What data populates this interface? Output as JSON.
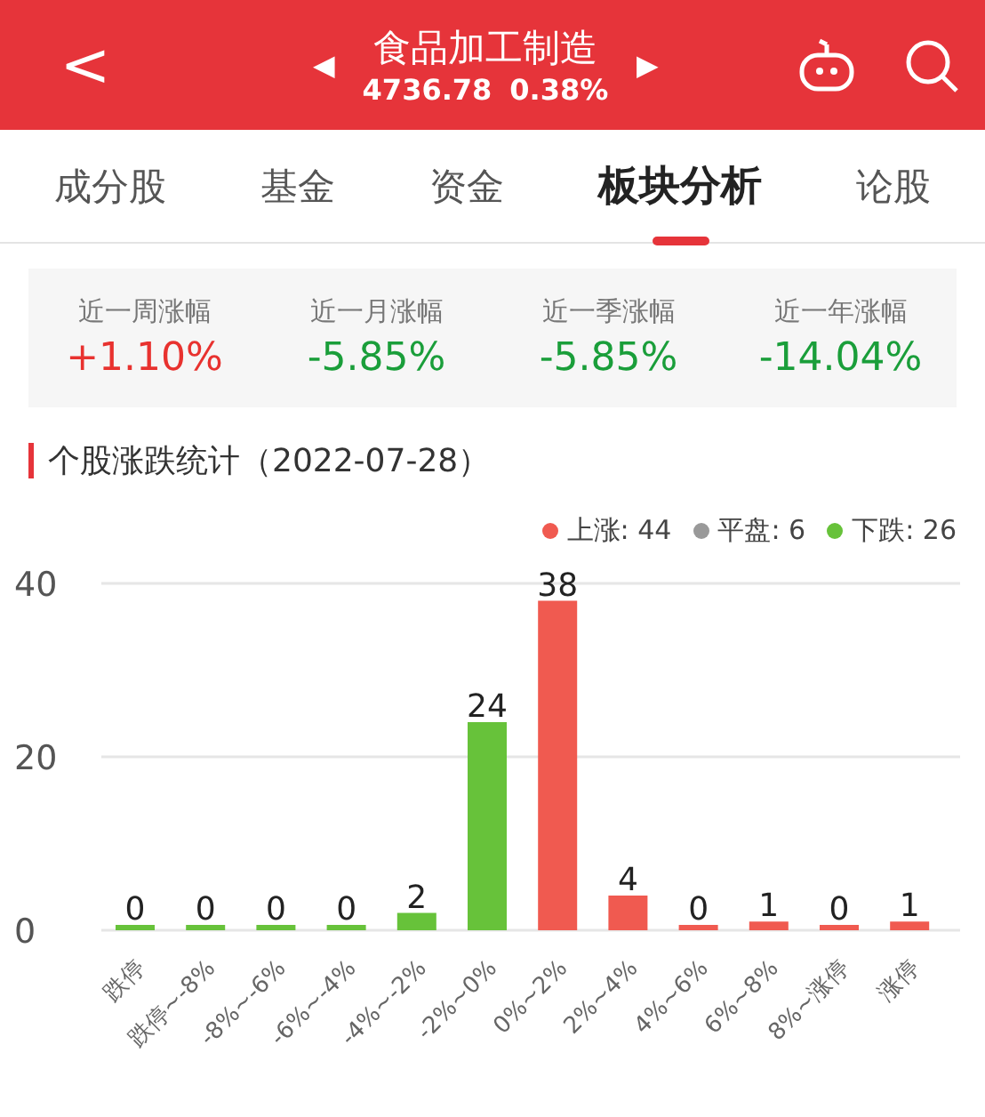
{
  "header": {
    "back": "<",
    "prev": "◀",
    "next": "▶",
    "title": "食品加工制造",
    "price": "4736.78",
    "change": "0.38%"
  },
  "tabs": [
    {
      "label": "成分股",
      "selected": false
    },
    {
      "label": "基金",
      "selected": false
    },
    {
      "label": "资金",
      "selected": false
    },
    {
      "label": "板块分析",
      "selected": true
    },
    {
      "label": "论股",
      "selected": false
    }
  ],
  "stats": [
    {
      "label": "近一周涨幅",
      "value": "+1.10%",
      "color": "#e8322f"
    },
    {
      "label": "近一月涨幅",
      "value": "-5.85%",
      "color": "#1a9e3a"
    },
    {
      "label": "近一季涨幅",
      "value": "-5.85%",
      "color": "#1a9e3a"
    },
    {
      "label": "近一年涨幅",
      "value": "-14.04%",
      "color": "#1a9e3a"
    }
  ],
  "section_title": "个股涨跌统计（2022-07-28）",
  "legend": [
    {
      "label": "上涨: 44",
      "color": "#f05a50"
    },
    {
      "label": "平盘: 6",
      "color": "#999999"
    },
    {
      "label": "下跌: 26",
      "color": "#67c23a"
    }
  ],
  "chart_data": {
    "type": "bar",
    "categories": [
      "跌停",
      "跌停~-8%",
      "-8%~-6%",
      "-6%~-4%",
      "-4%~-2%",
      "-2%~0%",
      "0%~2%",
      "2%~4%",
      "4%~6%",
      "6%~8%",
      "8%~涨停",
      "涨停"
    ],
    "series": [
      {
        "color": "#67c23a",
        "values": [
          0,
          0,
          0,
          0,
          2,
          24,
          null,
          null,
          null,
          null,
          null,
          null
        ]
      },
      {
        "color": "#f05a50",
        "values": [
          null,
          null,
          null,
          null,
          null,
          null,
          38,
          4,
          0,
          1,
          0,
          1
        ]
      }
    ],
    "ylim": [
      0,
      40
    ],
    "yticks": [
      0,
      20,
      40
    ],
    "data_labels": true
  }
}
